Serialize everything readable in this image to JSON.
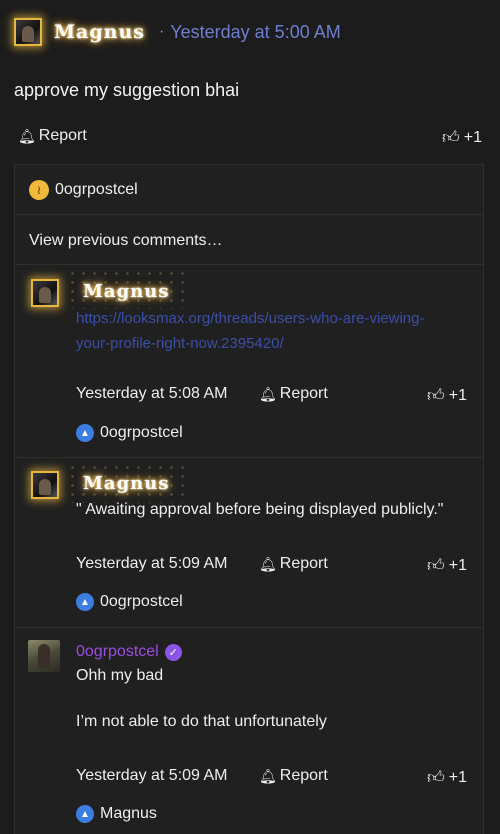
{
  "post": {
    "author": "Magnus",
    "separator": "·",
    "time": "Yesterday at 5:00 AM",
    "body": "approve my suggestion bhai",
    "report_label": "Report",
    "reaction_count": "+1"
  },
  "comments": {
    "top_reactor": "0ogrpostcel",
    "view_previous": "View previous comments…",
    "items": [
      {
        "author": "Magnus",
        "link": "https://looksmax.org/threads/users-who-are-viewing-your-profile-right-now.2395420/",
        "time": "Yesterday at 5:08 AM",
        "report_label": "Report",
        "reaction_count": "+1",
        "reactor": "0ogrpostcel"
      },
      {
        "author": "Magnus",
        "text": "\" Awaiting approval before being displayed publicly.\"",
        "time": "Yesterday at 5:09 AM",
        "report_label": "Report",
        "reaction_count": "+1",
        "reactor": "0ogrpostcel"
      },
      {
        "author": "0ogrpostcel",
        "line1": "Ohh my bad",
        "line2": "I’m not able to do that unfortunately",
        "time": "Yesterday at 5:09 AM",
        "report_label": "Report",
        "reaction_count": "+1",
        "reactor": "Magnus"
      }
    ]
  },
  "icons": {
    "bell": "bell-icon",
    "thumb": "thumbs-up-icon",
    "verified": "verified-badge-icon",
    "thinking": "thinking-emoji-icon"
  },
  "colors": {
    "background": "#1c1c1c",
    "link": "#3a4fa8",
    "time_accent": "#6f7fd0",
    "username_purple": "#9a4ee0",
    "glow_gold": "#e7b640"
  }
}
